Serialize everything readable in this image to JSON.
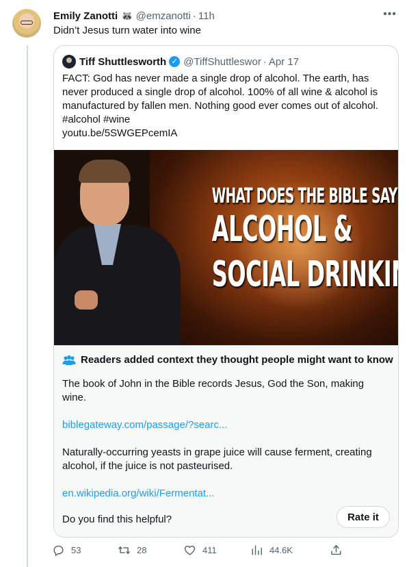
{
  "tweet": {
    "author_name": "Emily Zanotti",
    "author_emoji": "🦝",
    "handle": "@emzanotti",
    "separator": "·",
    "time": "11h",
    "text": "Didn’t Jesus turn water into wine",
    "more_icon": "more-horizontal-icon"
  },
  "quote": {
    "author_name": "Tiff Shuttlesworth",
    "verified_icon": "verified-badge-icon",
    "handle": "@TiffShuttleswor",
    "separator": "·",
    "time": "Apr 17",
    "text_lines": [
      "FACT: God has never made a single drop of alcohol. The earth, has",
      "never produced a single drop of alcohol. 100% of all wine & alcohol is",
      "manufactured by fallen men. Nothing good ever comes out of alcohol.",
      "#alcohol #wine",
      "youtu.be/5SWGEPcemIA"
    ],
    "media": {
      "title_line1": "WHAT DOES THE BIBLE SAY ABOUT",
      "title_line2": "ALCOHOL &",
      "title_line3": "SOCIAL DRINKING"
    }
  },
  "community_note": {
    "heading": "Readers added context they thought people might want to know",
    "heading_icon": "people-icon",
    "paragraph1": "The book of John in the Bible records Jesus, God the Son, making wine.",
    "link1": "biblegateway.com/passage/?searc...",
    "paragraph2": "Naturally-occurring yeasts in grape juice will cause ferment, creating alcohol, if the juice is not pasteurised.",
    "link2": "en.wikipedia.org/wiki/Fermentat...",
    "helpful_prompt": "Do you find this helpful?",
    "rate_button": "Rate it"
  },
  "actions": {
    "replies": "53",
    "retweets": "28",
    "likes": "411",
    "views": "44.6K",
    "icons": [
      "reply-icon",
      "retweet-icon",
      "like-icon",
      "views-icon",
      "share-icon"
    ]
  },
  "colors": {
    "link": "#1d9bf0",
    "secondary_text": "#536471",
    "border": "#cfd9de",
    "note_background": "#f7f9f9"
  }
}
